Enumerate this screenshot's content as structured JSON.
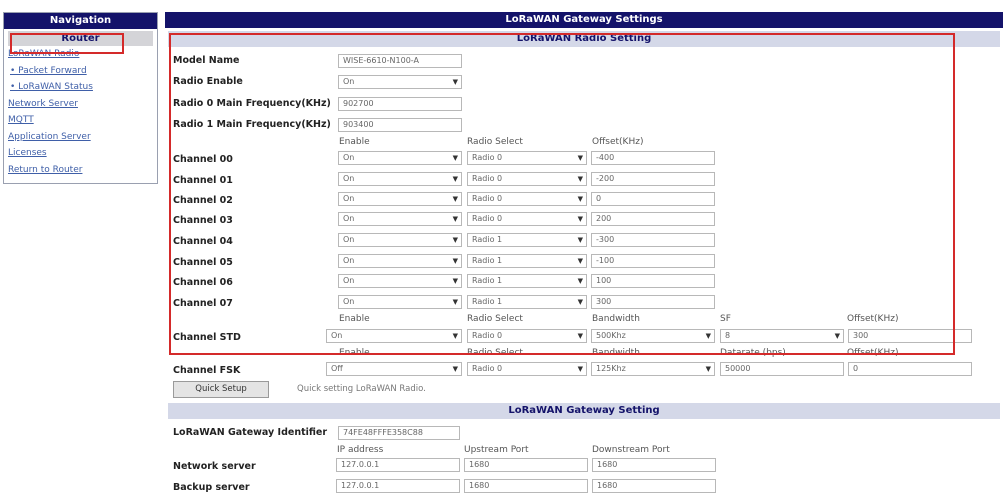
{
  "nav": {
    "title": "Navigation",
    "section": "Router",
    "items": [
      {
        "label": "LoRaWAN Radio"
      },
      {
        "label": "• Packet Forward"
      },
      {
        "label": "• LoRaWAN Status"
      },
      {
        "label": "Network Server"
      },
      {
        "label": "MQTT"
      },
      {
        "label": "Application Server"
      },
      {
        "label": "Licenses"
      },
      {
        "label": "Return to Router"
      }
    ]
  },
  "page": {
    "title": "LoRaWAN Gateway Settings"
  },
  "radio": {
    "section_title": "LoRaWAN Radio Setting",
    "model_name_label": "Model Name",
    "model_name_value": "WISE-6610-N100-A",
    "radio_enable_label": "Radio Enable",
    "radio_enable_value": "On",
    "radio0_label": "Radio 0 Main Frequency(KHz)",
    "radio0_value": "902700",
    "radio1_label": "Radio 1 Main Frequency(KHz)",
    "radio1_value": "903400",
    "col_enable": "Enable",
    "col_radio_select": "Radio Select",
    "col_offset": "Offset(KHz)",
    "channels": [
      {
        "label": "Channel 00",
        "enable": "On",
        "radio": "Radio 0",
        "offset": "-400"
      },
      {
        "label": "Channel 01",
        "enable": "On",
        "radio": "Radio 0",
        "offset": "-200"
      },
      {
        "label": "Channel 02",
        "enable": "On",
        "radio": "Radio 0",
        "offset": "0"
      },
      {
        "label": "Channel 03",
        "enable": "On",
        "radio": "Radio 0",
        "offset": "200"
      },
      {
        "label": "Channel 04",
        "enable": "On",
        "radio": "Radio 1",
        "offset": "-300"
      },
      {
        "label": "Channel 05",
        "enable": "On",
        "radio": "Radio 1",
        "offset": "-100"
      },
      {
        "label": "Channel 06",
        "enable": "On",
        "radio": "Radio 1",
        "offset": "100"
      },
      {
        "label": "Channel 07",
        "enable": "On",
        "radio": "Radio 1",
        "offset": "300"
      }
    ],
    "std": {
      "col_enable": "Enable",
      "col_radio_select": "Radio Select",
      "col_bandwidth": "Bandwidth",
      "col_sf": "SF",
      "col_offset": "Offset(KHz)",
      "label": "Channel STD",
      "enable": "On",
      "radio": "Radio 0",
      "bandwidth": "500Khz",
      "sf": "8",
      "offset": "300"
    },
    "fsk": {
      "col_enable": "Enable",
      "col_radio_select": "Radio Select",
      "col_bandwidth": "Bandwidth",
      "col_datarate": "Datarate (bps)",
      "col_offset": "Offset(KHz)",
      "label": "Channel FSK",
      "enable": "Off",
      "radio": "Radio 0",
      "bandwidth": "125Khz",
      "datarate": "50000",
      "offset": "0"
    },
    "quick_setup_label": "Quick Setup",
    "quick_setup_hint": "Quick setting LoRaWAN Radio."
  },
  "gateway": {
    "section_title": "LoRaWAN Gateway Setting",
    "id_label": "LoRaWAN Gateway Identifier",
    "id_value": "74FE48FFFE358C88",
    "col_ip": "IP address",
    "col_up": "Upstream Port",
    "col_down": "Downstream Port",
    "servers": [
      {
        "label": "Network server",
        "ip": "127.0.0.1",
        "up": "1680",
        "down": "1680"
      },
      {
        "label": "Backup server",
        "ip": "127.0.0.1",
        "up": "1680",
        "down": "1680"
      }
    ]
  }
}
